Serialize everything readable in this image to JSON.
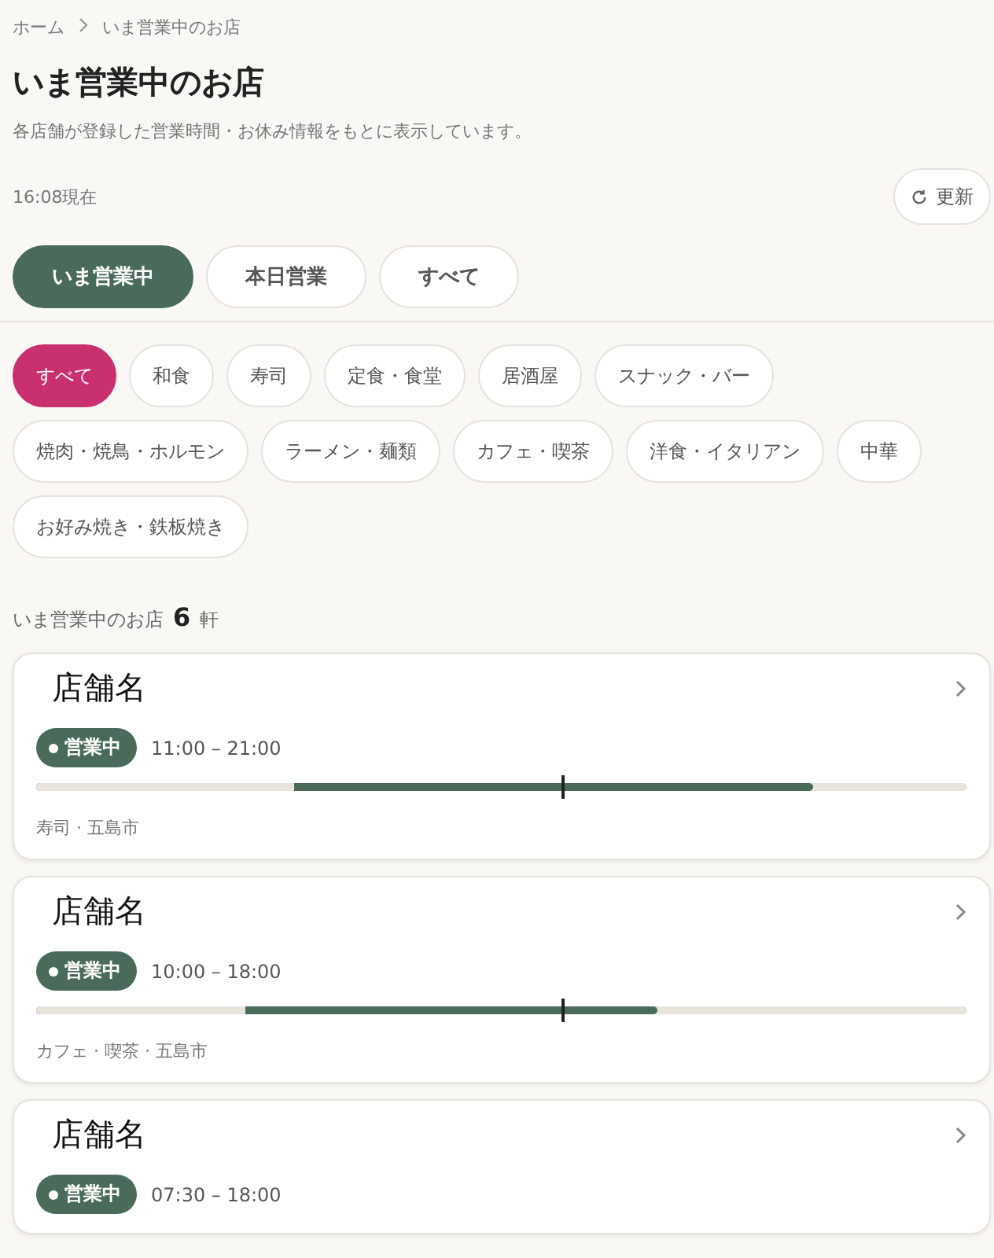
{
  "breadcrumb": [
    {
      "label": "ホーム"
    },
    {
      "label": "いま営業中のお店"
    }
  ],
  "title": "いま営業中のお店",
  "description": "各店舗が登録した営業時間・お休み情報をもとに表示しています。",
  "timestamp": "16:08現在",
  "refresh_button": "更新",
  "tabs": [
    {
      "label": "いま営業中",
      "selected": true
    },
    {
      "label": "本日営業",
      "selected": false
    },
    {
      "label": "すべて",
      "selected": false
    }
  ],
  "categories": [
    {
      "label": "すべて",
      "selected": true
    },
    {
      "label": "和食",
      "selected": false
    },
    {
      "label": "寿司",
      "selected": false
    },
    {
      "label": "定食・食堂",
      "selected": false
    },
    {
      "label": "居酒屋",
      "selected": false
    },
    {
      "label": "スナック・バー",
      "selected": false
    },
    {
      "label": "焼肉・焼鳥・ホルモン",
      "selected": false
    },
    {
      "label": "ラーメン・麺類",
      "selected": false
    },
    {
      "label": "カフェ・喫茶",
      "selected": false
    },
    {
      "label": "洋食・イタリアン",
      "selected": false
    },
    {
      "label": "中華",
      "selected": false
    },
    {
      "label": "お好み焼き・鉄板焼き",
      "selected": false
    }
  ],
  "result_count": {
    "label": "いま営業中のお店",
    "count": "6",
    "unit": "軒"
  },
  "shops": [
    {
      "name": "店舗名",
      "status": "営業中",
      "hours": "11:00 – 21:00",
      "timeline": {
        "segments": [
          {
            "kind": "open",
            "level": 0.834
          },
          {
            "kind": "closed",
            "level": 0.277
          }
        ],
        "now_marker": {
          "level": 0.565
        }
      },
      "meta": "寿司 · 五島市"
    },
    {
      "name": "店舗名",
      "status": "営業中",
      "hours": "10:00 – 18:00",
      "timeline": {
        "segments": [
          {
            "kind": "open",
            "level": 0.667
          },
          {
            "kind": "closed",
            "level": 0.224
          }
        ],
        "now_marker": {
          "level": 0.565
        }
      },
      "meta": "カフェ · 喫茶 · 五島市"
    },
    {
      "name": "店舗名",
      "status": "営業中",
      "hours": "07:30 – 18:00"
    }
  ]
}
